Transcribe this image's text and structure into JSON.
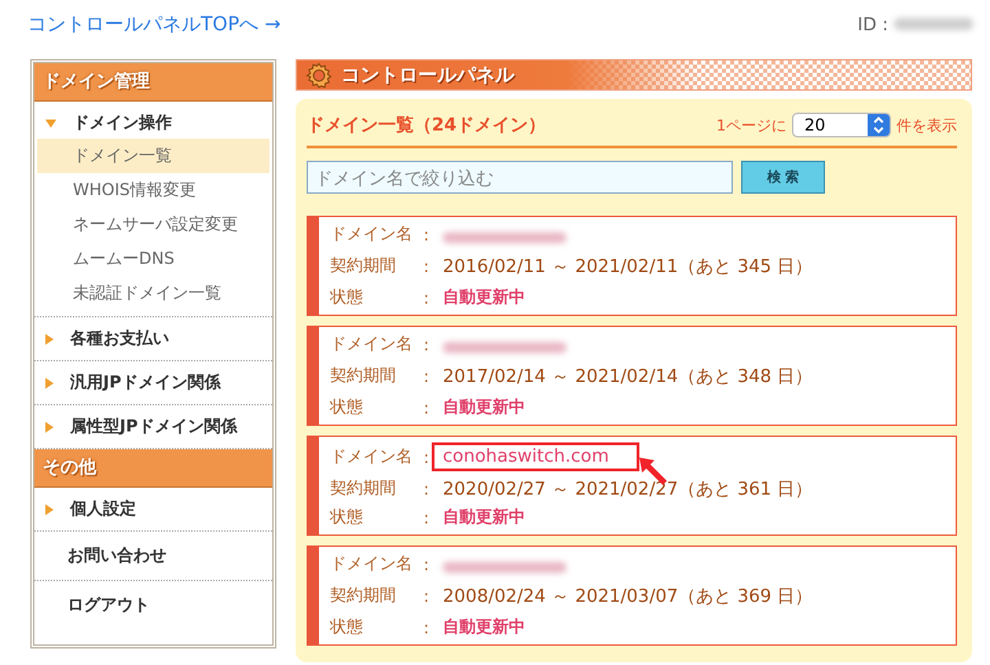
{
  "top_link": {
    "label": "コントロールパネルTOPへ →"
  },
  "account": {
    "label": "ID :",
    "value_redacted": true
  },
  "sidebar": {
    "sections": [
      {
        "title": "ドメイン管理",
        "items": [
          {
            "kind": "group",
            "label": "ドメイン操作",
            "expanded": true,
            "children": [
              {
                "label": "ドメイン一覧",
                "selected": true
              },
              {
                "label": "WHOIS情報変更",
                "selected": false
              },
              {
                "label": "ネームサーバ設定変更",
                "selected": false
              },
              {
                "label": "ムームーDNS",
                "selected": false
              },
              {
                "label": "未認証ドメイン一覧",
                "selected": false
              }
            ]
          },
          {
            "kind": "group",
            "label": "各種お支払い",
            "expanded": false
          },
          {
            "kind": "group",
            "label": "汎用JPドメイン関係",
            "expanded": false
          },
          {
            "kind": "group",
            "label": "属性型JPドメイン関係",
            "expanded": false
          }
        ]
      },
      {
        "title": "その他",
        "items": [
          {
            "kind": "group",
            "label": "個人設定",
            "expanded": false
          },
          {
            "kind": "link",
            "label": "お問い合わせ"
          },
          {
            "kind": "link",
            "label": "ログアウト"
          }
        ]
      }
    ]
  },
  "panel": {
    "title": "コントロールパネル",
    "list_title": "ドメイン一覧（24ドメイン）",
    "per_page": {
      "prefix": "1ページに",
      "value": "20",
      "suffix": "件を表示"
    },
    "search": {
      "placeholder": "ドメイン名で絞り込む",
      "button": "検 索"
    },
    "domains": [
      {
        "domain_label": "ドメイン名",
        "domain_sep": ":",
        "name_redacted": true,
        "highlighted": false,
        "period_label": "契約期間",
        "period_sep": ":",
        "period": "2016/02/11 ～ 2021/02/11（あと 345 日）",
        "status_label": "状態",
        "status_sep": ":",
        "status": "自動更新中"
      },
      {
        "domain_label": "ドメイン名",
        "domain_sep": ":",
        "name_redacted": true,
        "highlighted": false,
        "period_label": "契約期間",
        "period_sep": ":",
        "period": "2017/02/14 ～ 2021/02/14（あと 348 日）",
        "status_label": "状態",
        "status_sep": ":",
        "status": "自動更新中"
      },
      {
        "domain_label": "ドメイン名",
        "domain_sep": ":",
        "name": "conohaswitch.com",
        "highlighted": true,
        "period_label": "契約期間",
        "period_sep": ":",
        "period": "2020/02/27 ～ 2021/02/27（あと 361 日）",
        "status_label": "状態",
        "status_sep": ":",
        "status": "自動更新中"
      },
      {
        "domain_label": "ドメイン名",
        "domain_sep": ":",
        "name_redacted": true,
        "highlighted": false,
        "period_label": "契約期間",
        "period_sep": ":",
        "period": "2008/02/24 ～ 2021/03/07（あと 369 日）",
        "status_label": "状態",
        "status_sep": ":",
        "status": "自動更新中"
      }
    ]
  }
}
